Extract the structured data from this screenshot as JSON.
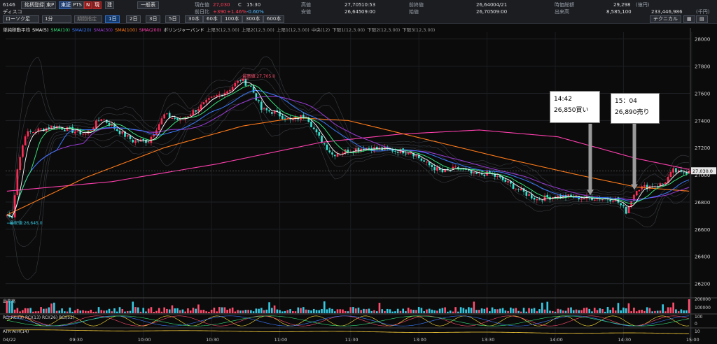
{
  "header": {
    "code": "6146",
    "name": "ディスコ",
    "buttons": [
      "銘柄登録",
      "東P",
      "東証",
      "PTS",
      "N",
      "現",
      "建",
      "一般表"
    ],
    "chart_type": "ローソク足",
    "interval": "1分",
    "period_placeholder": "期間指定",
    "interval_buttons": [
      "1日",
      "2日",
      "3日",
      "5日",
      "30本",
      "60本",
      "100本",
      "300本",
      "600本"
    ],
    "current_label": "現在値",
    "current_value": "27,030",
    "current_flag": "C",
    "current_time": "15:30",
    "prev_label": "前日比",
    "prev_change": "+390",
    "prev_pct": "+1.46%",
    "prev_pct2": "-0.60%",
    "high_label": "高値",
    "high_value": "27,705",
    "high_time": "10:53",
    "low_label": "安値",
    "low_value": "26,645",
    "low_time": "09:00",
    "prevclose_label": "前終値",
    "prevclose_value": "26,640",
    "prevclose_date": "04/21",
    "open_label": "始値",
    "open_value": "26,705",
    "open_time": "09:00",
    "mcap_label": "時価総額",
    "mcap_value": "29,298",
    "mcap_unit": "(億円)",
    "volume_label": "出来高",
    "volume_value": "8,585,100",
    "turnover_value": "233,446,986",
    "turnover_unit": "(千円)",
    "technical_button": "テクニカル"
  },
  "legend": {
    "items": [
      {
        "text": "単純移動平均",
        "color": "#dddddd"
      },
      {
        "text": "SMA(5)",
        "color": "#ffffff"
      },
      {
        "text": "SMA(10)",
        "color": "#35e07a"
      },
      {
        "text": "SMA(20)",
        "color": "#3a7bff"
      },
      {
        "text": "SMA(30)",
        "color": "#9b3bd6"
      },
      {
        "text": "SMA(100)",
        "color": "#ff7a1a"
      },
      {
        "text": "SMA(200)",
        "color": "#ff3fae"
      },
      {
        "text": "ボリンジャーバンド",
        "color": "#dddddd"
      },
      {
        "text": "上限3(12,3.00)",
        "color": "#999999"
      },
      {
        "text": "上限2(12,3.00)",
        "color": "#999999"
      },
      {
        "text": "上限1(12,3.00)",
        "color": "#999999"
      },
      {
        "text": "中央(12)",
        "color": "#999999"
      },
      {
        "text": "下限1(12,3.00)",
        "color": "#999999"
      },
      {
        "text": "下限2(12,3.00)",
        "color": "#999999"
      },
      {
        "text": "下限3(12,3.00)",
        "color": "#999999"
      }
    ]
  },
  "chart_data": {
    "type": "candlestick",
    "title": "",
    "date_label": "04/22",
    "x_ticks": [
      "09:30",
      "10:00",
      "10:30",
      "11:00",
      "11:30",
      "13:00",
      "13:30",
      "14:00",
      "14:30",
      "15:00"
    ],
    "y_ticks": [
      28000,
      27800,
      27600,
      27400,
      27200,
      27000,
      26800,
      26600,
      26400,
      26200
    ],
    "ylim": [
      26100,
      28050
    ],
    "last_price_label": "27,030.0",
    "last_price": 27030,
    "high_marker": {
      "label": "最高値:27,705.0",
      "value": 27705
    },
    "low_marker": {
      "label": "最安値:26,645.0",
      "value": 26645
    },
    "ma_colors": {
      "sma5": "#ffffff",
      "sma10": "#35e07a",
      "sma20": "#3a7bff",
      "sma30": "#9b3bd6",
      "sma100": "#ff7a1a",
      "sma200": "#ff3fae"
    },
    "up_color": "#ff2d55",
    "down_color": "#37e2cf",
    "price_keypoints": [
      [
        0,
        26705
      ],
      [
        2,
        26680
      ],
      [
        4,
        27050
      ],
      [
        7,
        27300
      ],
      [
        12,
        27330
      ],
      [
        18,
        27360
      ],
      [
        24,
        27330
      ],
      [
        30,
        27300
      ],
      [
        36,
        27420
      ],
      [
        42,
        27330
      ],
      [
        48,
        27250
      ],
      [
        54,
        27250
      ],
      [
        60,
        27440
      ],
      [
        66,
        27400
      ],
      [
        72,
        27480
      ],
      [
        78,
        27560
      ],
      [
        84,
        27620
      ],
      [
        89,
        27700
      ],
      [
        93,
        27650
      ],
      [
        97,
        27480
      ],
      [
        102,
        27460
      ],
      [
        108,
        27400
      ],
      [
        114,
        27440
      ],
      [
        118,
        27300
      ],
      [
        124,
        27150
      ],
      [
        130,
        27180
      ],
      [
        136,
        27200
      ],
      [
        142,
        27190
      ],
      [
        148,
        27180
      ],
      [
        154,
        27170
      ],
      [
        160,
        27080
      ],
      [
        166,
        27020
      ],
      [
        172,
        27050
      ],
      [
        178,
        27000
      ],
      [
        184,
        27010
      ],
      [
        190,
        26950
      ],
      [
        196,
        26880
      ],
      [
        202,
        26820
      ],
      [
        208,
        26840
      ],
      [
        214,
        26840
      ],
      [
        220,
        26830
      ],
      [
        226,
        26830
      ],
      [
        232,
        26820
      ],
      [
        236,
        26730
      ],
      [
        240,
        26900
      ],
      [
        246,
        26920
      ],
      [
        250,
        26930
      ],
      [
        254,
        27030
      ],
      [
        257,
        27010
      ],
      [
        260,
        27030
      ]
    ],
    "sma100_keypoints": [
      [
        0,
        26705
      ],
      [
        30,
        26980
      ],
      [
        60,
        27200
      ],
      [
        90,
        27360
      ],
      [
        110,
        27420
      ],
      [
        130,
        27400
      ],
      [
        160,
        27260
      ],
      [
        190,
        27120
      ],
      [
        220,
        26990
      ],
      [
        240,
        26910
      ],
      [
        260,
        26880
      ]
    ],
    "sma200_keypoints": [
      [
        0,
        26880
      ],
      [
        40,
        26950
      ],
      [
        80,
        27080
      ],
      [
        120,
        27240
      ],
      [
        150,
        27300
      ],
      [
        180,
        27330
      ],
      [
        210,
        27280
      ],
      [
        240,
        27120
      ],
      [
        260,
        27040
      ]
    ],
    "volume_panel": {
      "label": "出来高",
      "y_ticks": [
        "200000",
        "100000"
      ]
    },
    "rci_panel": {
      "label": "RCI",
      "series": [
        "RCI(9)",
        "RCI(13)",
        "RCI(26)",
        "RCI(52)"
      ],
      "y_ticks": [
        "100",
        "0"
      ]
    },
    "atr_panel": {
      "label": "ATR",
      "series": [
        "ATR(14)"
      ],
      "y_ticks": [
        "10"
      ]
    }
  },
  "annotations": [
    {
      "time": "14:42",
      "text": "26,850買い"
    },
    {
      "time": "15：04",
      "text": "26,890売り"
    }
  ]
}
